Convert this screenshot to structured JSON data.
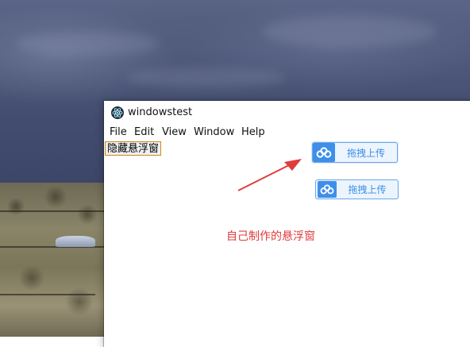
{
  "window": {
    "title": "windowstest",
    "icon": "electron-app-icon"
  },
  "menu": {
    "items": [
      {
        "label": "File"
      },
      {
        "label": "Edit"
      },
      {
        "label": "View"
      },
      {
        "label": "Window"
      },
      {
        "label": "Help"
      }
    ]
  },
  "content": {
    "hide_button_label": "隐藏悬浮窗",
    "upload_buttons": [
      {
        "label": "拖拽上传",
        "icon": "baidu-cloud-icon"
      },
      {
        "label": "拖拽上传",
        "icon": "baidu-cloud-icon"
      }
    ],
    "annotation": "自己制作的悬浮窗",
    "annotation_icon": "red-arrow-icon"
  },
  "colors": {
    "accent": "#3d8fe8",
    "annotation": "#e03c3c"
  }
}
